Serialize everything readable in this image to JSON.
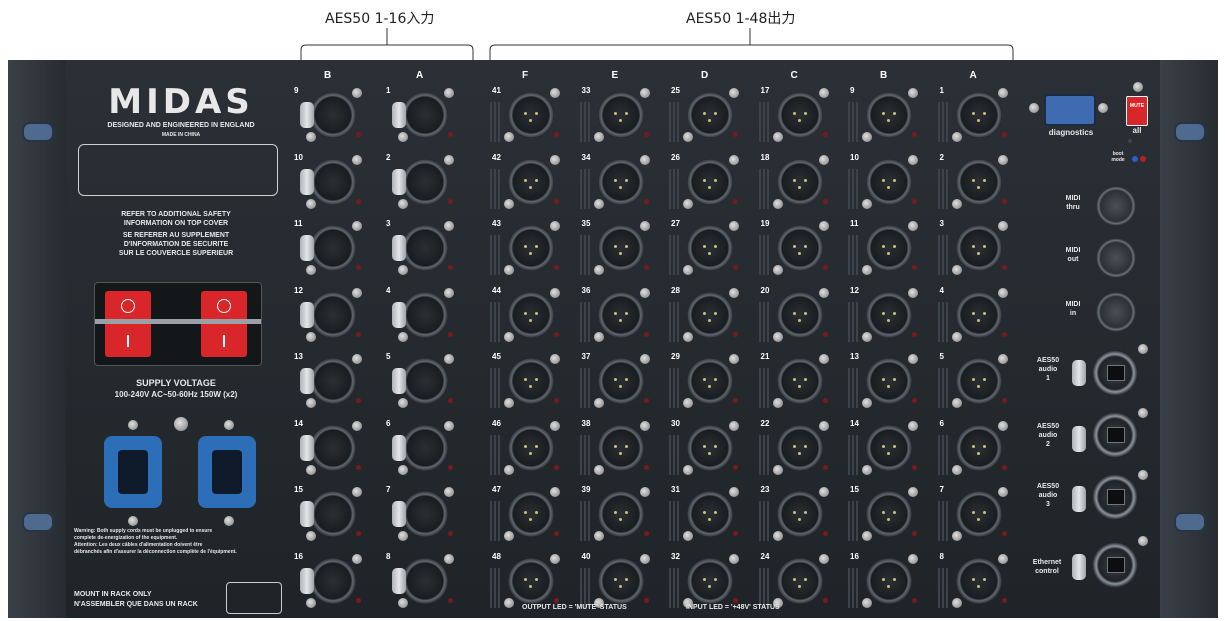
{
  "annotations": {
    "input_label": "AES50 1-16入力",
    "output_label": "AES50 1-48出力"
  },
  "brand": {
    "logo": "MIDAS",
    "tagline": "DESIGNED AND ENGINEERED IN ENGLAND",
    "made_in": "MADE IN CHINA"
  },
  "safety": {
    "en_1": "REFER TO ADDITIONAL SAFETY",
    "en_2": "INFORMATION ON TOP COVER",
    "fr_1": "SE REFERER AU SUPPLEMENT",
    "fr_2": "D'INFORMATION DE SECURITE",
    "fr_3": "SUR LE COUVERCLE SUPERIEUR"
  },
  "power": {
    "title": "SUPPLY VOLTAGE",
    "spec": "100-240V  AC~50-60Hz 150W (x2)",
    "warning_1": "Warning: Both supply cords must be unplugged to ensure",
    "warning_2": "complete de-energization of the equipment.",
    "warning_3": "Attention: Les deux câbles d'alimentation doivent être",
    "warning_4": "débranchés afin d'assurer la déconnection complète de l'équipment.",
    "rack_1": "MOUNT IN RACK ONLY",
    "rack_2": "N'ASSEMBLER QUE DANS UN RACK"
  },
  "input_columns": [
    {
      "letter": "B",
      "numbers": [
        "9",
        "10",
        "11",
        "12",
        "13",
        "14",
        "15",
        "16"
      ]
    },
    {
      "letter": "A",
      "numbers": [
        "1",
        "2",
        "3",
        "4",
        "5",
        "6",
        "7",
        "8"
      ]
    }
  ],
  "output_columns": [
    {
      "letter": "F",
      "numbers": [
        "41",
        "42",
        "43",
        "44",
        "45",
        "46",
        "47",
        "48"
      ]
    },
    {
      "letter": "E",
      "numbers": [
        "33",
        "34",
        "35",
        "36",
        "37",
        "38",
        "39",
        "40"
      ]
    },
    {
      "letter": "D",
      "numbers": [
        "25",
        "26",
        "27",
        "28",
        "29",
        "30",
        "31",
        "32"
      ]
    },
    {
      "letter": "C",
      "numbers": [
        "17",
        "18",
        "19",
        "20",
        "21",
        "22",
        "23",
        "24"
      ]
    },
    {
      "letter": "B",
      "numbers": [
        "9",
        "10",
        "11",
        "12",
        "13",
        "14",
        "15",
        "16"
      ]
    },
    {
      "letter": "A",
      "numbers": [
        "1",
        "2",
        "3",
        "4",
        "5",
        "6",
        "7",
        "8"
      ]
    }
  ],
  "status_bar": {
    "output_led": "OUTPUT LED = 'MUTE' STATUS",
    "input_led": "INPUT LED = '+48V' STATUS"
  },
  "right_panel": {
    "diagnostics": "diagnostics",
    "mute_button": "MUTE",
    "mute_all": "all",
    "boot_mode_1": "boot",
    "boot_mode_2": "mode",
    "midi_thru_1": "MIDI",
    "midi_thru_2": "thru",
    "midi_out_1": "MIDI",
    "midi_out_2": "out",
    "midi_in_1": "MIDI",
    "midi_in_2": "in",
    "aes1_1": "AES50",
    "aes1_2": "audio",
    "aes1_3": "1",
    "aes2_1": "AES50",
    "aes2_2": "audio",
    "aes2_3": "2",
    "aes3_1": "AES50",
    "aes3_2": "audio",
    "aes3_3": "3",
    "eth_1": "Ethernet",
    "eth_2": "control"
  },
  "colors": {
    "panel": "#1f2428",
    "power_switch": "#d8262a",
    "iec_socket": "#2c6fb8",
    "mute_button": "#d8262a"
  }
}
